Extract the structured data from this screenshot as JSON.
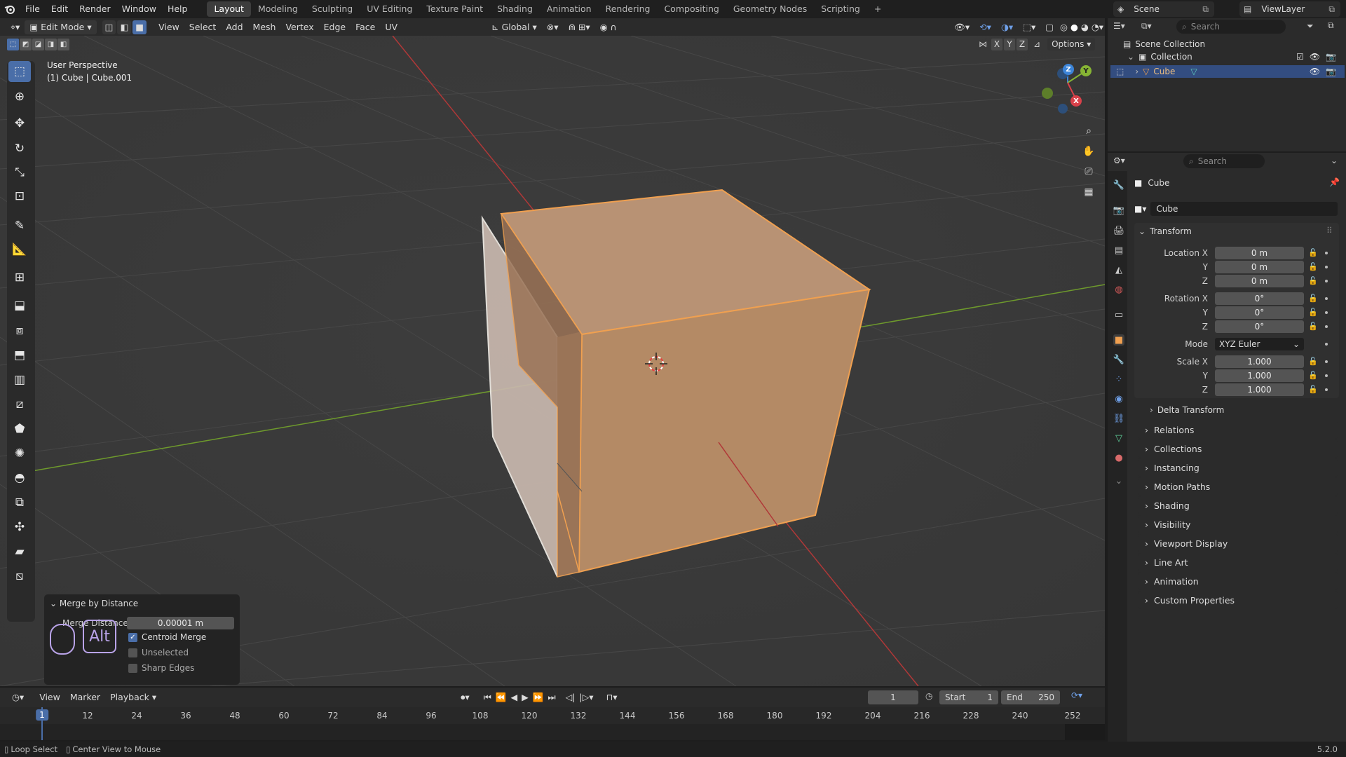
{
  "topbar": {
    "menus": [
      "File",
      "Edit",
      "Render",
      "Window",
      "Help"
    ],
    "workspaces": [
      "Layout",
      "Modeling",
      "Sculpting",
      "UV Editing",
      "Texture Paint",
      "Shading",
      "Animation",
      "Rendering",
      "Compositing",
      "Geometry Nodes",
      "Scripting"
    ],
    "add_tab": "+",
    "scene_label": "Scene",
    "viewlayer_label": "ViewLayer"
  },
  "viewport_header": {
    "mode": "Edit Mode",
    "menus": [
      "View",
      "Select",
      "Add",
      "Mesh",
      "Vertex",
      "Edge",
      "Face",
      "UV"
    ],
    "orientation": "Global",
    "axes": [
      "X",
      "Y",
      "Z"
    ],
    "options": "Options"
  },
  "viewport": {
    "perspective": "User Perspective",
    "object_info": "(1) Cube | Cube.001",
    "gizmo_labels": {
      "x": "X",
      "y": "Y",
      "z": "Z"
    }
  },
  "operator_panel": {
    "title": "Merge by Distance",
    "merge_distance_label": "Merge Distance",
    "merge_distance_value": "0.00001 m",
    "key_hint": "Alt",
    "options": [
      {
        "label": "Centroid Merge",
        "checked": true
      },
      {
        "label": "Unselected",
        "checked": false
      },
      {
        "label": "Sharp Edges",
        "checked": false
      }
    ]
  },
  "outliner": {
    "search_placeholder": "Search",
    "scene_collection": "Scene Collection",
    "collection": "Collection",
    "object": "Cube"
  },
  "properties": {
    "search_placeholder": "Search",
    "object_name": "Cube",
    "datablock_name": "Cube",
    "transform_title": "Transform",
    "location_label": "Location X",
    "rotation_label": "Rotation X",
    "scale_label": "Scale X",
    "axis_y": "Y",
    "axis_z": "Z",
    "location": [
      "0 m",
      "0 m",
      "0 m"
    ],
    "rotation": [
      "0°",
      "0°",
      "0°"
    ],
    "mode_label": "Mode",
    "mode_value": "XYZ Euler",
    "scale": [
      "1.000",
      "1.000",
      "1.000"
    ],
    "delta_transform": "Delta Transform",
    "sections": [
      "Relations",
      "Collections",
      "Instancing",
      "Motion Paths",
      "Shading",
      "Visibility",
      "Viewport Display",
      "Line Art",
      "Animation",
      "Custom Properties"
    ]
  },
  "timeline": {
    "menus": [
      "View",
      "Marker",
      "Playback"
    ],
    "current_frame": "1",
    "start_label": "Start",
    "start_value": "1",
    "end_label": "End",
    "end_value": "250",
    "ticks": [
      "1",
      "12",
      "24",
      "36",
      "48",
      "60",
      "72",
      "84",
      "96",
      "108",
      "120",
      "132",
      "144",
      "156",
      "168",
      "180",
      "192",
      "204",
      "216",
      "228",
      "240",
      "252"
    ]
  },
  "statusbar": {
    "hint1": "Loop Select",
    "hint2": "Center View to Mouse",
    "version": "5.2.0"
  },
  "colors": {
    "accent": "#4a6ea8",
    "selection_orange": "#f0a050",
    "x_axis": "#d8414a",
    "y_axis": "#86b434",
    "z_axis": "#3c84d8"
  }
}
